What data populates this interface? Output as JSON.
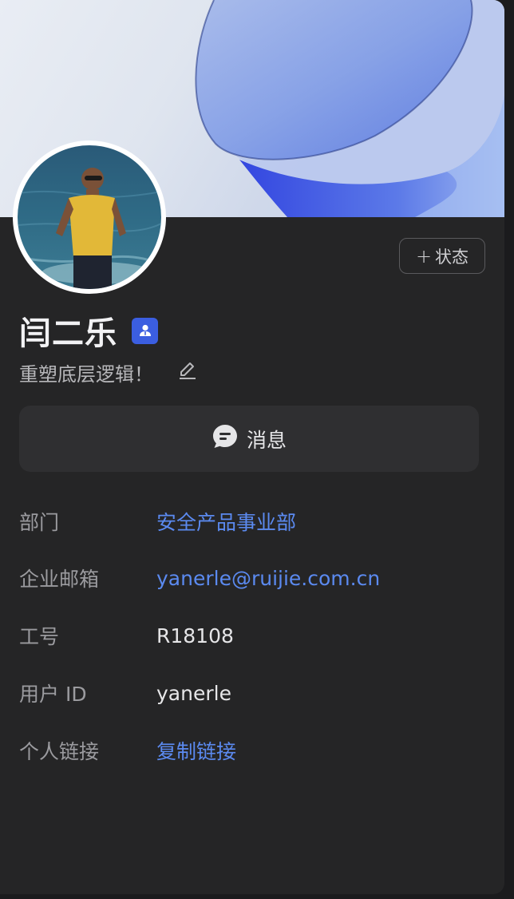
{
  "profile": {
    "name": "闫二乐",
    "signature": "重塑底层逻辑！",
    "status_button_label": "状态",
    "message_button_label": "消息"
  },
  "info": {
    "rows": [
      {
        "label": "部门",
        "value": "安全产品事业部"
      },
      {
        "label": "企业邮箱",
        "value": "yanerle@ruijie.com.cn"
      },
      {
        "label": "工号",
        "value": "R18108"
      },
      {
        "label": "用户 ID",
        "value": "yanerle"
      },
      {
        "label": "个人链接",
        "value": "复制链接"
      }
    ]
  },
  "colors": {
    "card_background": "#252526",
    "accent_blue": "#3b5ee0",
    "link_blue": "#5b8af0",
    "label_gray": "#9b9b9f"
  },
  "icons": {
    "status": "plus-icon",
    "badge": "person-badge-icon",
    "edit": "pencil-icon",
    "message": "chat-bubble-icon"
  }
}
